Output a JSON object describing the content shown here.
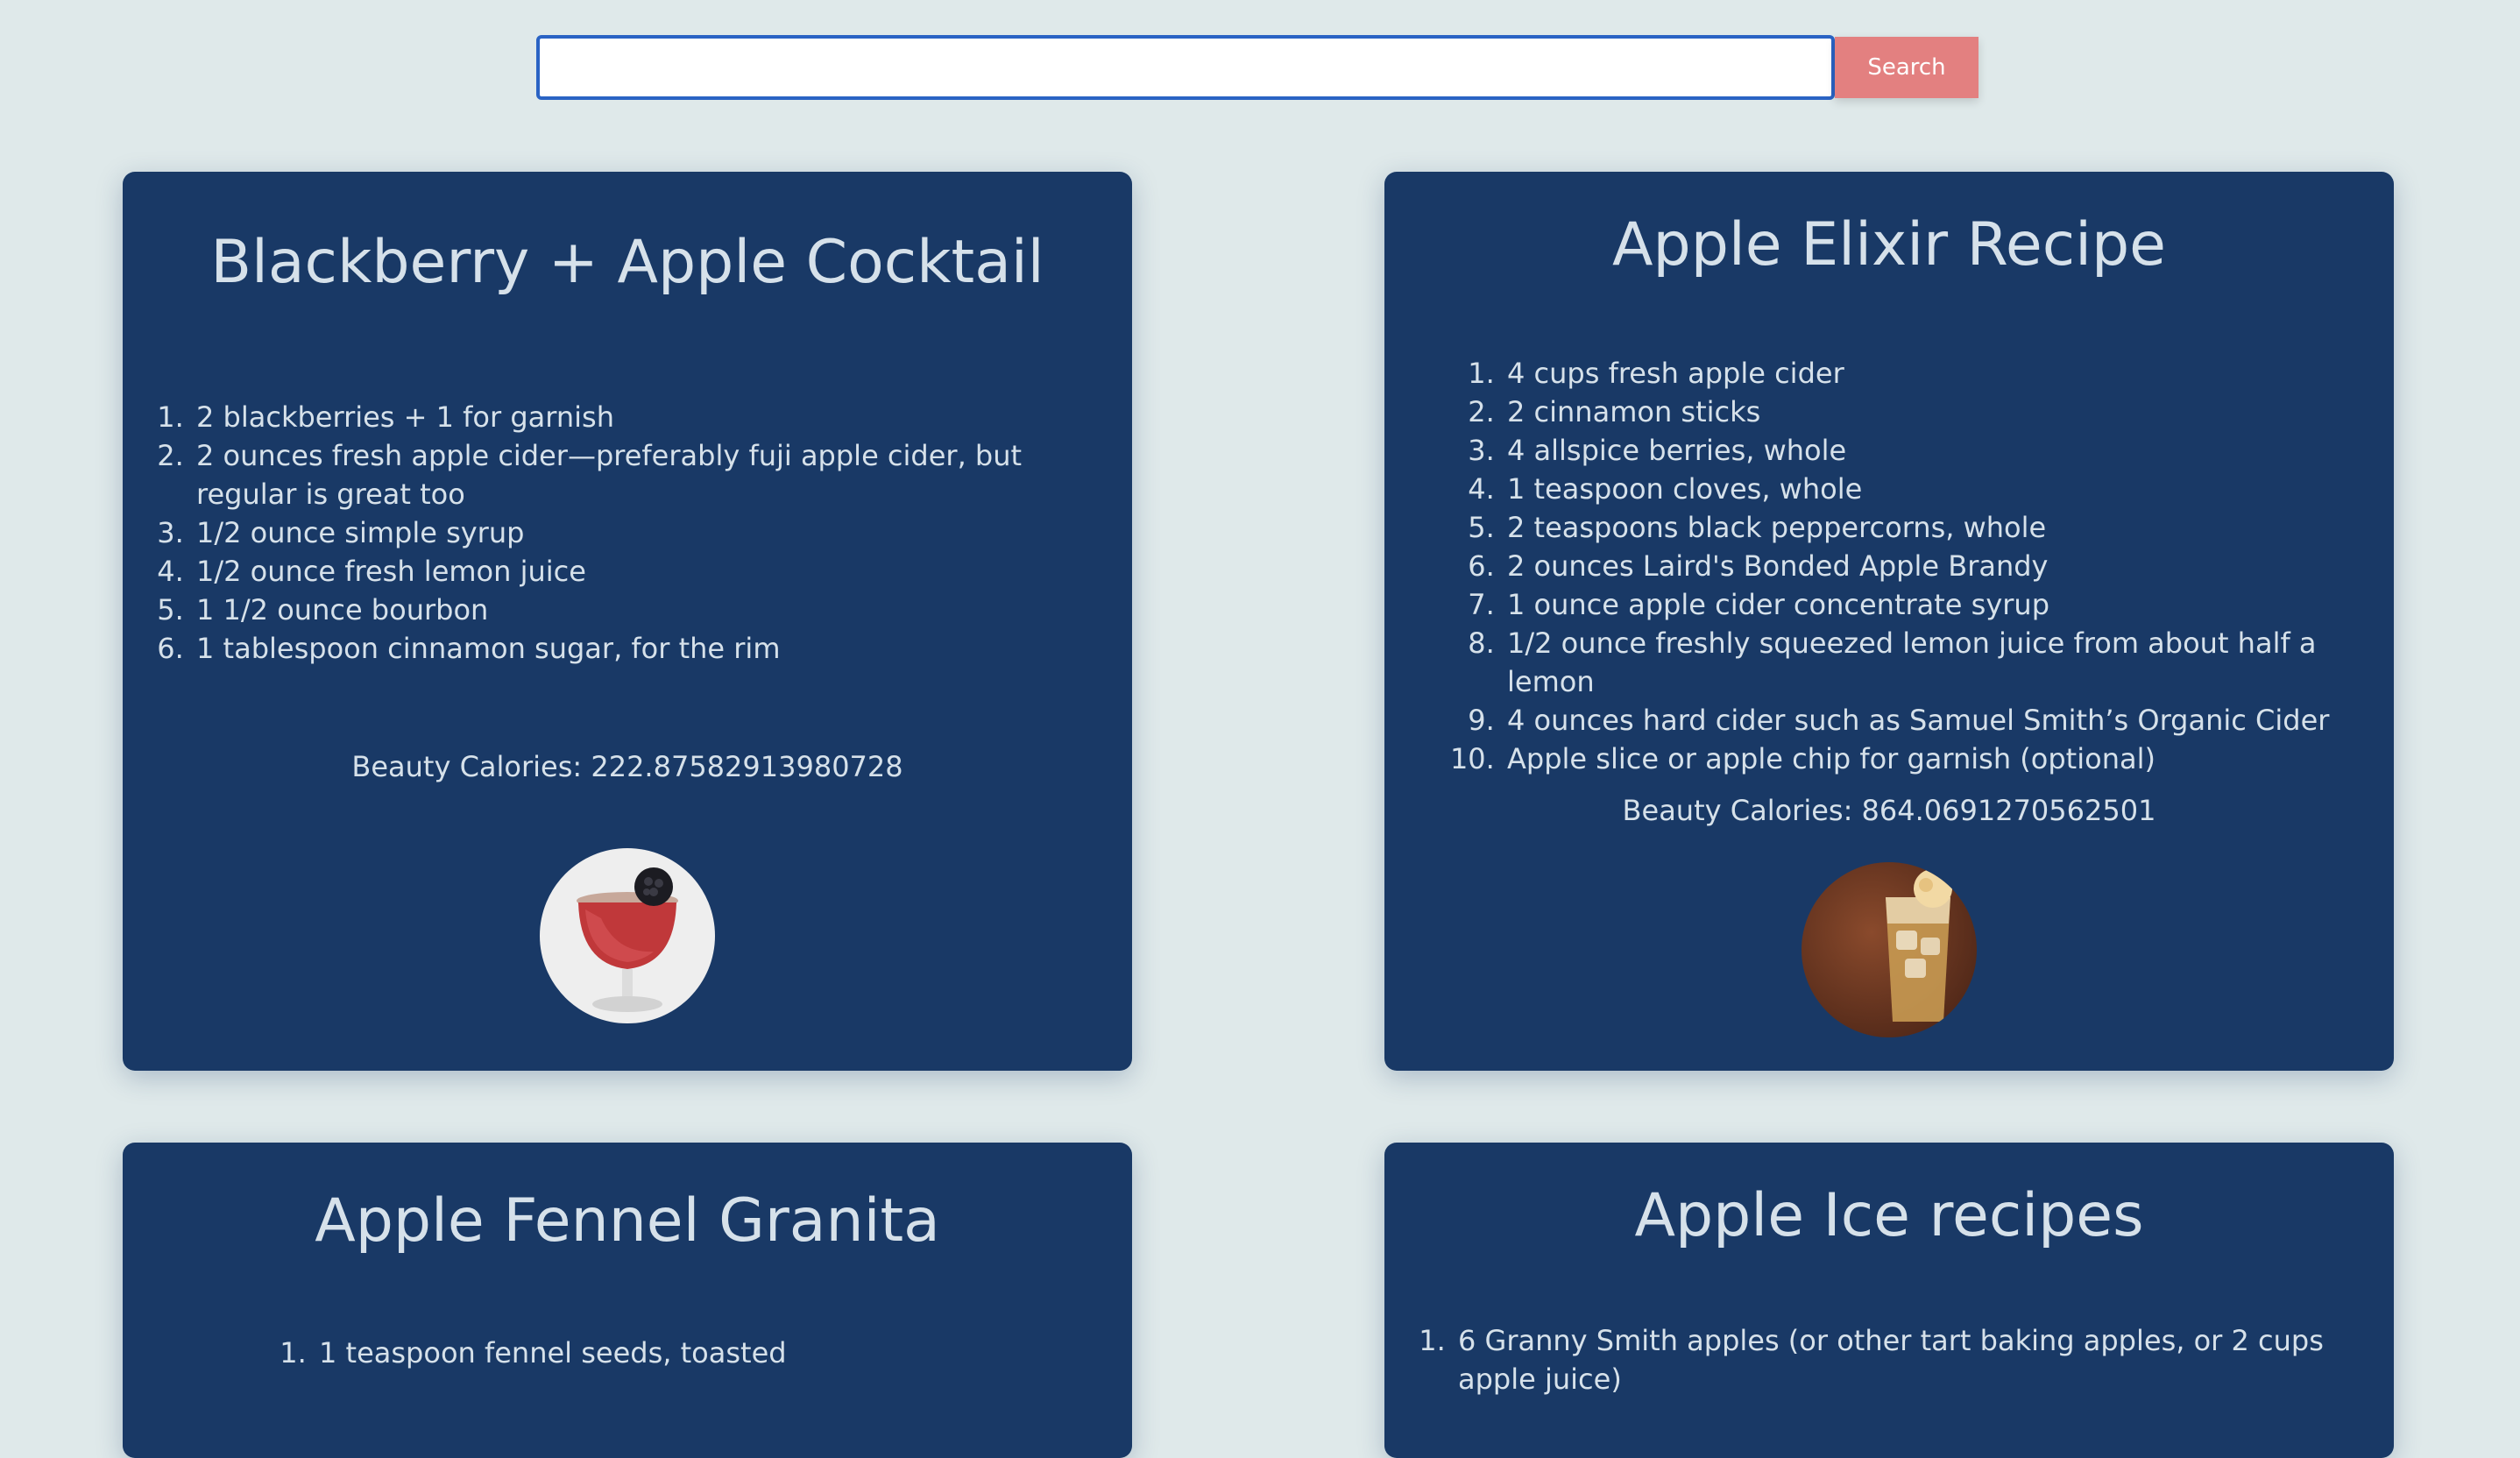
{
  "search": {
    "value": "",
    "placeholder": "",
    "button_label": "Search"
  },
  "calories_label": "Beauty Calories: ",
  "recipes": [
    {
      "title": "Blackberry + Apple Cocktail",
      "ingredients": [
        "2 blackberries + 1 for garnish",
        "2 ounces fresh apple cider—preferably fuji apple cider, but regular is great too",
        "1/2 ounce simple syrup",
        "1/2 ounce fresh lemon juice",
        "1 1/2 ounce bourbon",
        "1 tablespoon cinnamon sugar, for the rim"
      ],
      "calories": "222.87582913980728",
      "image": "cocktail-glass-image"
    },
    {
      "title": "Apple Elixir Recipe",
      "ingredients": [
        "4 cups fresh apple cider",
        "2 cinnamon sticks",
        "4 allspice berries, whole",
        "1 teaspoon cloves, whole",
        "2 teaspoons black peppercorns, whole",
        "2 ounces Laird's Bonded Apple Brandy",
        "1 ounce apple cider concentrate syrup",
        "1/2 ounce freshly squeezed lemon juice from about half a lemon",
        "4 ounces hard cider such as Samuel Smith’s Organic Cider",
        "Apple slice or apple chip for garnish (optional)"
      ],
      "calories": "864.0691270562501",
      "image": "iced-drink-image"
    },
    {
      "title": "Apple Fennel Granita",
      "ingredients": [
        "1 teaspoon fennel seeds, toasted"
      ]
    },
    {
      "title": "Apple Ice recipes",
      "ingredients": [
        "6 Granny Smith apples (or other tart baking apples, or 2 cups apple juice)"
      ]
    }
  ],
  "colors": {
    "background": "#dfe9ea",
    "card": "#193966",
    "card_text": "#d6e1ea",
    "search_button": "#e38080",
    "input_border": "#2a63c4"
  }
}
